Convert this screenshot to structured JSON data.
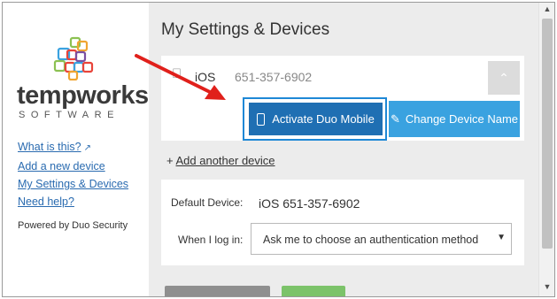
{
  "brand": {
    "wordmark": "tempworks",
    "subtitle": "SOFTWARE",
    "colors": [
      "#e8443a",
      "#f0a531",
      "#8cc152",
      "#3aa2e0",
      "#7b4fa0"
    ]
  },
  "sidebar": {
    "links": [
      {
        "label": "What is this?",
        "icon": "external-link-icon"
      },
      {
        "label": "Add a new device"
      },
      {
        "label": "My Settings & Devices"
      },
      {
        "label": "Need help?"
      }
    ],
    "powered_by": "Powered by Duo Security"
  },
  "main": {
    "title": "My Settings & Devices",
    "device": {
      "os_icon": "apple-icon",
      "name": "iOS",
      "phone": "651-357-6902",
      "collapse_icon": "chevron-up-icon",
      "activate_label": "Activate Duo Mobile",
      "change_label": "Change Device Name"
    },
    "add_another_prefix": "+ ",
    "add_another_label": "Add another device",
    "default_device_label": "Default Device:",
    "default_device_value": "iOS 651-357-6902",
    "when_login_label": "When I log in:",
    "when_login_selected": "Ask me to choose an authentication method"
  },
  "colors": {
    "primary": "#1f6fb3",
    "secondary": "#3aa2e0",
    "highlight_border": "#1e88d6",
    "annotation_arrow": "#e0201b",
    "link": "#2a6bb0"
  }
}
